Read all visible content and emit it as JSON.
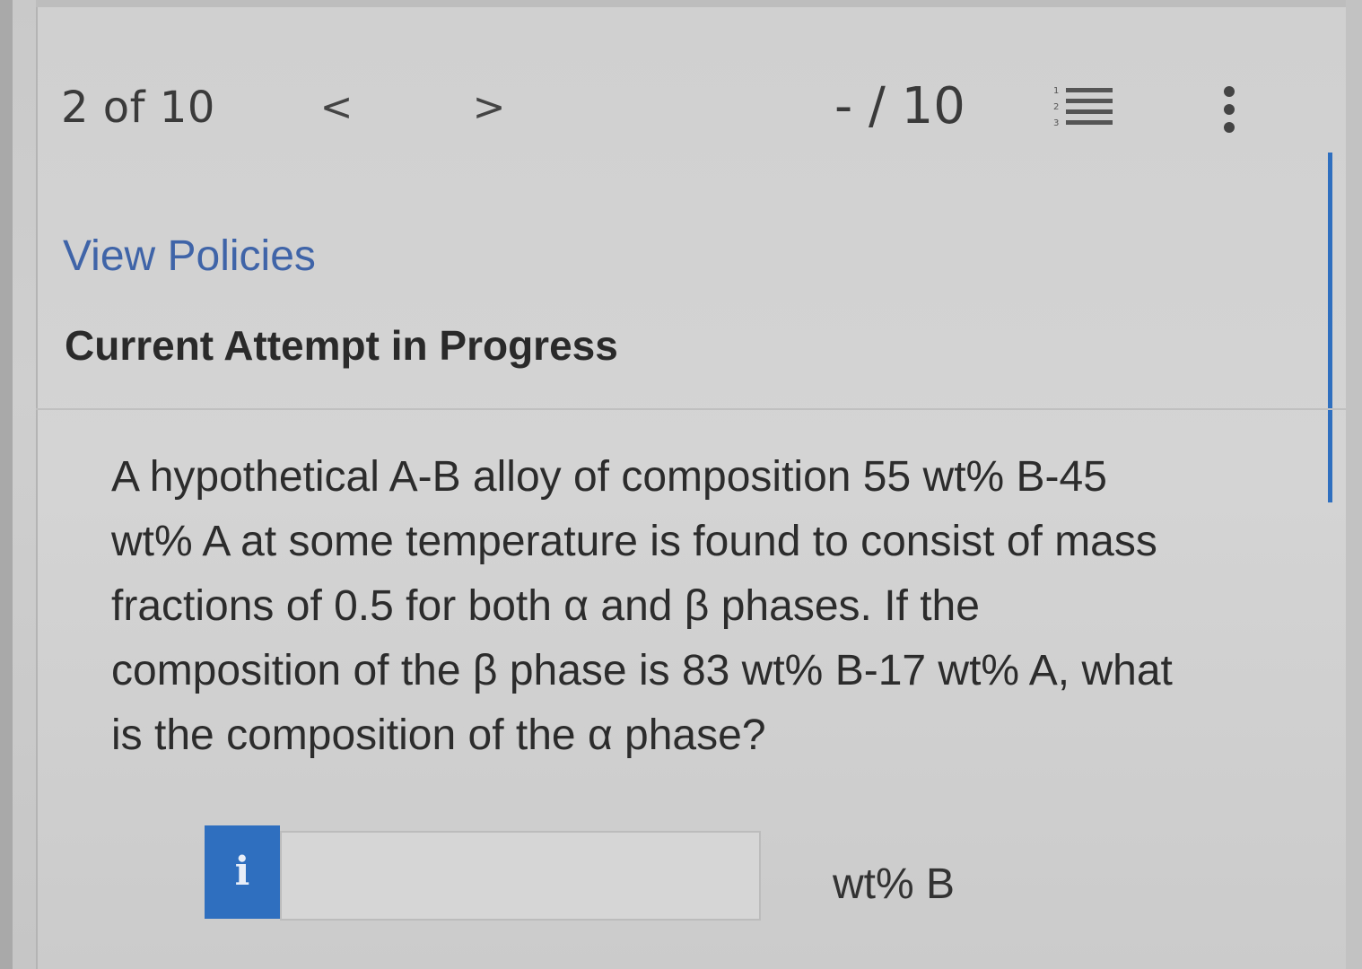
{
  "header": {
    "question_counter": "2 of 10",
    "prev_label": "<",
    "next_label": ">",
    "score": "- / 10",
    "list_icon": "numbered-list-icon",
    "more_icon": "more-vertical-icon"
  },
  "policies_link": "View Policies",
  "status_heading": "Current Attempt in Progress",
  "question": {
    "lines": [
      "A hypothetical A-B alloy of composition 55 wt% B-45",
      "wt% A at some temperature is found to consist of mass",
      "fractions of 0.5 for both α and β phases. If the",
      "composition of the β phase is 83 wt% B-17 wt% A, what",
      "is the composition of the α phase?"
    ]
  },
  "answer": {
    "info_label": "i",
    "value": "",
    "unit": "wt% B"
  },
  "colors": {
    "accent": "#2f6fbf",
    "link": "#3f64a8",
    "text": "#2c2c2c"
  }
}
